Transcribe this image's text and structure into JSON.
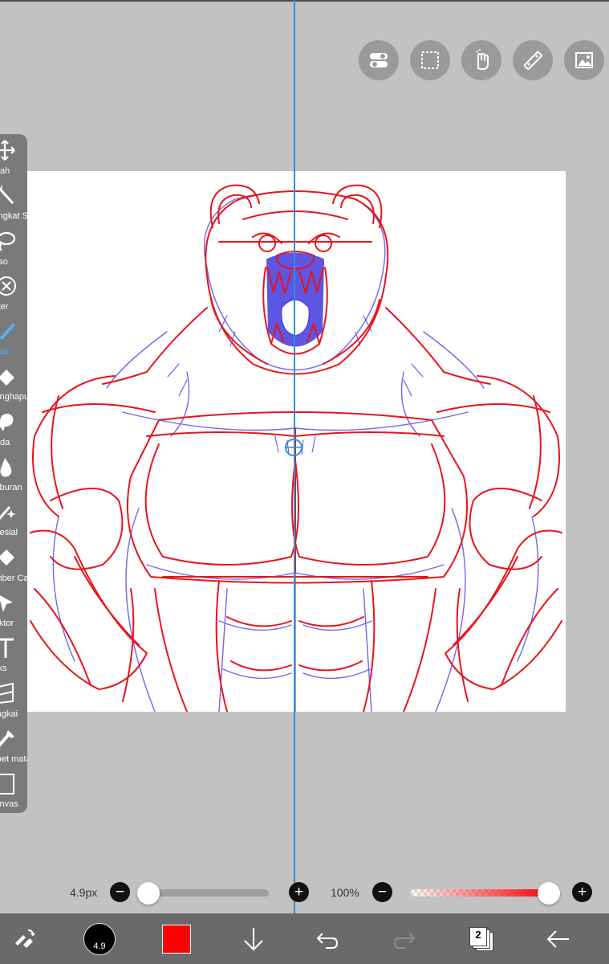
{
  "toolbar_top": {
    "items": [
      {
        "name": "toggle-icon"
      },
      {
        "name": "selection-icon"
      },
      {
        "name": "hand-icon"
      },
      {
        "name": "ruler-icon"
      },
      {
        "name": "image-icon"
      }
    ]
  },
  "tools": {
    "items": [
      {
        "label": "Ubah",
        "icon": "move-icon",
        "active": false
      },
      {
        "label": "Tongkat Sihir",
        "icon": "magic-wand-icon",
        "active": false
      },
      {
        "label": "Laso",
        "icon": "lasso-icon",
        "active": false
      },
      {
        "label": "Filter",
        "icon": "filter-icon",
        "active": false
      },
      {
        "label": "Kuas",
        "icon": "brush-icon",
        "active": true
      },
      {
        "label": "Penghapus",
        "icon": "eraser-icon",
        "active": false
      },
      {
        "label": "Noda",
        "icon": "smudge-icon",
        "active": false
      },
      {
        "label": "Kaburan",
        "icon": "blur-icon",
        "active": false
      },
      {
        "label": "Spesial",
        "icon": "special-icon",
        "active": false
      },
      {
        "label": "Ember Cat",
        "icon": "bucket-icon",
        "active": false
      },
      {
        "label": "Vektor",
        "icon": "vector-icon",
        "active": false
      },
      {
        "label": "Teks",
        "icon": "text-icon",
        "active": false
      },
      {
        "label": "Bingkai",
        "icon": "frame-icon",
        "active": false
      },
      {
        "label": "Pipet mata",
        "icon": "eyedropper-icon",
        "active": false
      },
      {
        "label": "Kanvas",
        "icon": "canvas-icon",
        "active": false
      }
    ]
  },
  "brush": {
    "size_label": "4.9px",
    "size_value": 4.9,
    "size_fraction": 0.03,
    "opacity_label": "100%",
    "opacity_fraction": 1.0,
    "color": "#ff0000"
  },
  "bottom": {
    "brush_size_badge": "4.9",
    "layer_count": "2"
  },
  "colors": {
    "guide": "#2f8fdc",
    "sketch_red": "#e8141c",
    "sketch_blue": "#5a4de0",
    "active_tool": "#58aef0"
  }
}
